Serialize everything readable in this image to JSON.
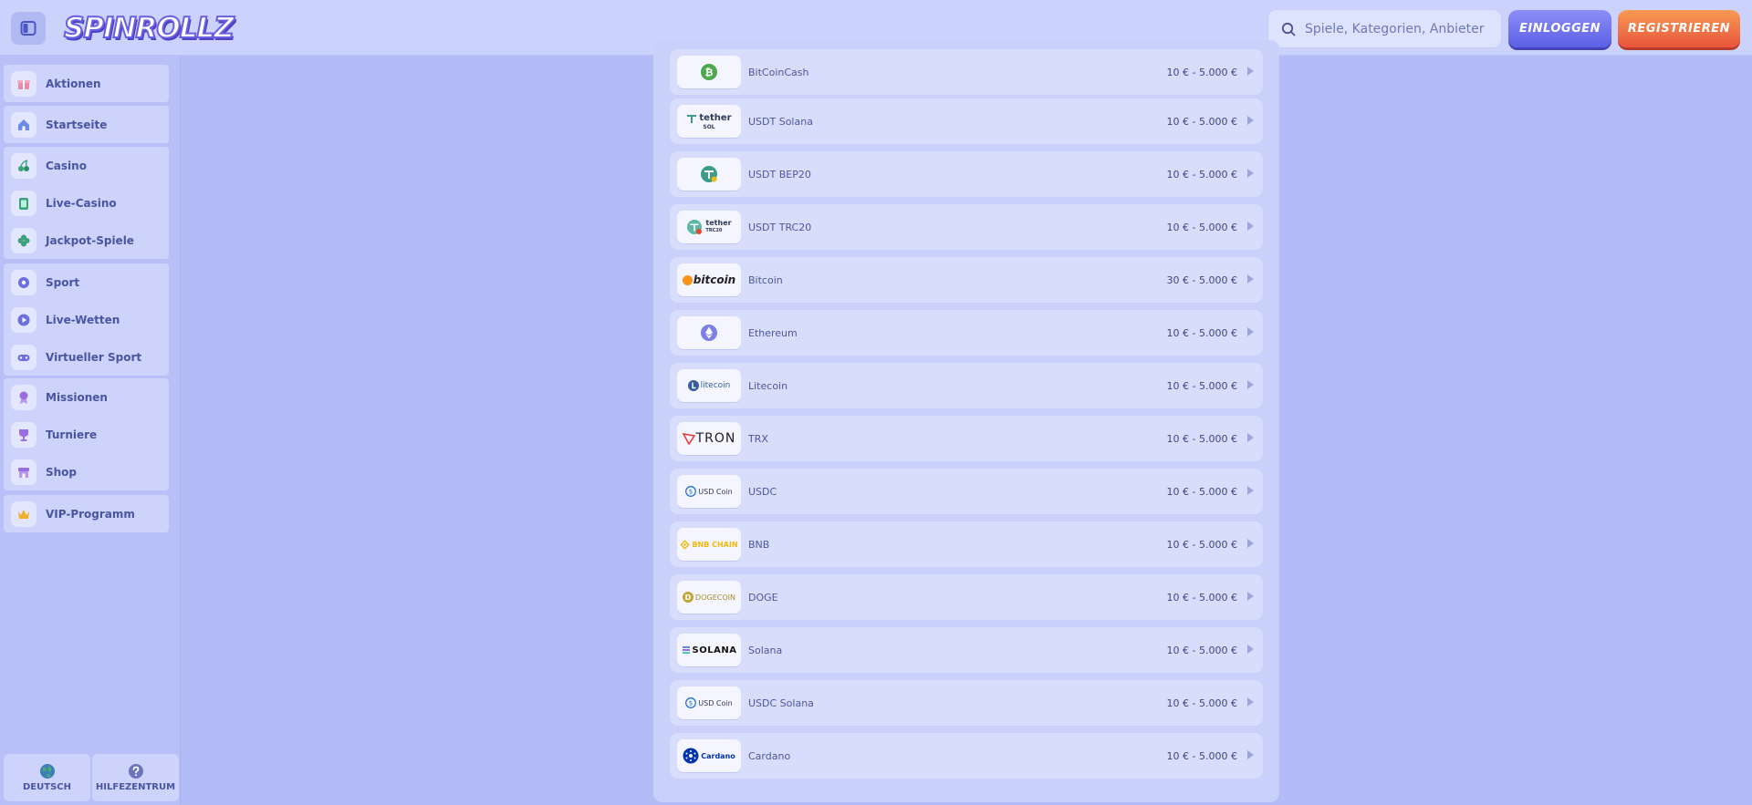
{
  "header": {
    "logo_text": "SPINROLLZ",
    "search_placeholder": "Spiele, Kategorien, Anbieter",
    "login_label": "EINLOGGEN",
    "register_label": "REGISTRIEREN"
  },
  "sidebar": {
    "groups": [
      {
        "items": [
          {
            "label": "Aktionen",
            "icon": "gift-icon",
            "color": "#e88aa8"
          }
        ]
      },
      {
        "items": [
          {
            "label": "Startseite",
            "icon": "home-icon",
            "color": "#6c8ae8"
          }
        ]
      },
      {
        "items": [
          {
            "label": "Casino",
            "icon": "cherry-icon",
            "color": "#3aa37a"
          },
          {
            "label": "Live-Casino",
            "icon": "card-icon",
            "color": "#3aa37a"
          },
          {
            "label": "Jackpot-Spiele",
            "icon": "clover-icon",
            "color": "#3aa37a"
          }
        ]
      },
      {
        "items": [
          {
            "label": "Sport",
            "icon": "ball-icon",
            "color": "#6c6fe0"
          },
          {
            "label": "Live-Wetten",
            "icon": "play-icon",
            "color": "#6c6fe0"
          },
          {
            "label": "Virtueller Sport",
            "icon": "gamepad-icon",
            "color": "#6c6fe0"
          }
        ]
      },
      {
        "items": [
          {
            "label": "Missionen",
            "icon": "medal-icon",
            "color": "#9a6ee0"
          },
          {
            "label": "Turniere",
            "icon": "trophy-icon",
            "color": "#9a6ee0"
          },
          {
            "label": "Shop",
            "icon": "shop-icon",
            "color": "#9a6ee0"
          }
        ]
      },
      {
        "items": [
          {
            "label": "VIP-Programm",
            "icon": "crown-icon",
            "color": "#f0b02e"
          }
        ]
      }
    ],
    "footer": {
      "language_label": "DEUTSCH",
      "help_label": "HILFEZENTRUM"
    }
  },
  "payments": [
    {
      "name": "BitCoinCash",
      "range": "10 € - 5.000 €",
      "logo_text": ""
    },
    {
      "name": "USDT Solana",
      "range": "10 € - 5.000 €",
      "logo_text": "tether",
      "logo_sub": "SOL"
    },
    {
      "name": "USDT BEP20",
      "range": "10 € - 5.000 €",
      "logo_text": ""
    },
    {
      "name": "USDT TRC20",
      "range": "10 € - 5.000 €",
      "logo_text": "tether",
      "logo_sub": "TRC20"
    },
    {
      "name": "Bitcoin",
      "range": "30 € - 5.000 €",
      "logo_text": "bitcoin"
    },
    {
      "name": "Ethereum",
      "range": "10 € - 5.000 €",
      "logo_text": ""
    },
    {
      "name": "Litecoin",
      "range": "10 € - 5.000 €",
      "logo_text": "litecoin"
    },
    {
      "name": "TRX",
      "range": "10 € - 5.000 €",
      "logo_text": "TRON"
    },
    {
      "name": "USDC",
      "range": "10 € - 5.000 €",
      "logo_text": "USD Coin"
    },
    {
      "name": "BNB",
      "range": "10 € - 5.000 €",
      "logo_text": "BNB CHAIN"
    },
    {
      "name": "DOGE",
      "range": "10 € - 5.000 €",
      "logo_text": "DOGECOIN"
    },
    {
      "name": "Solana",
      "range": "10 € - 5.000 €",
      "logo_text": "SOLANA"
    },
    {
      "name": "USDC Solana",
      "range": "10 € - 5.000 €",
      "logo_text": "USD Coin"
    },
    {
      "name": "Cardano",
      "range": "10 € - 5.000 €",
      "logo_text": "Cardano"
    }
  ]
}
